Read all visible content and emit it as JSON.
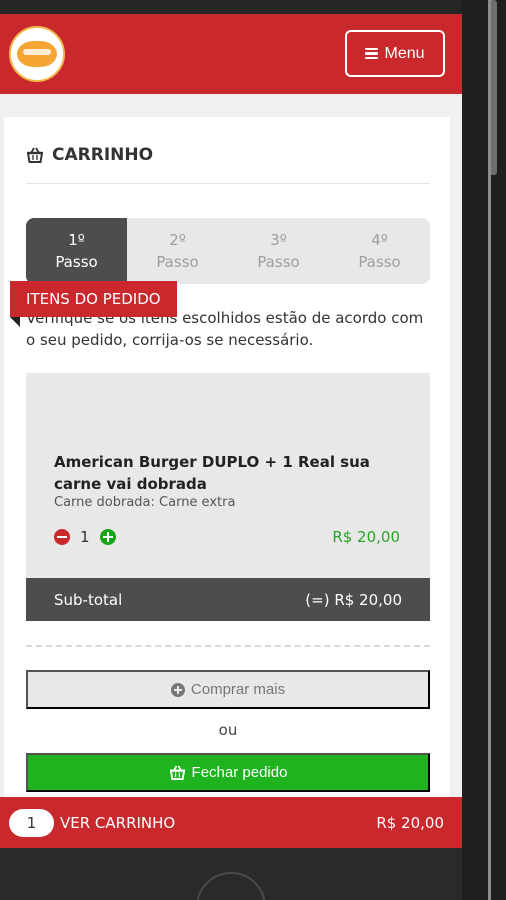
{
  "header": {
    "menu_label": "Menu"
  },
  "page": {
    "title": "CARRINHO"
  },
  "steps": [
    {
      "number": "1º",
      "label": "Passo",
      "active": true
    },
    {
      "number": "2º",
      "label": "Passo",
      "active": false
    },
    {
      "number": "3º",
      "label": "Passo",
      "active": false
    },
    {
      "number": "4º",
      "label": "Passo",
      "active": false
    }
  ],
  "info_text": "Verifique se os itens escolhidos estão de acordo com o seu pedido, corrija-os se necessário.",
  "order": {
    "section_label": "ITENS DO PEDIDO",
    "item": {
      "name": "American Burger DUPLO + 1 Real sua carne vai dobrada",
      "option": "Carne dobrada: Carne extra",
      "quantity": "1",
      "price": "R$ 20,00"
    },
    "subtotal_label": "Sub-total",
    "subtotal_value": "(=) R$ 20,00"
  },
  "actions": {
    "buy_more": "Comprar mais",
    "or": "ou",
    "close_order": "Fechar pedido"
  },
  "cart_bar": {
    "count": "1",
    "label": "VER CARRINHO",
    "total": "R$ 20,00"
  },
  "colors": {
    "brand_red": "#c9282d",
    "dark_gray": "#4d4d4d",
    "green": "#1fb31f",
    "price_green": "#2aa52a"
  }
}
